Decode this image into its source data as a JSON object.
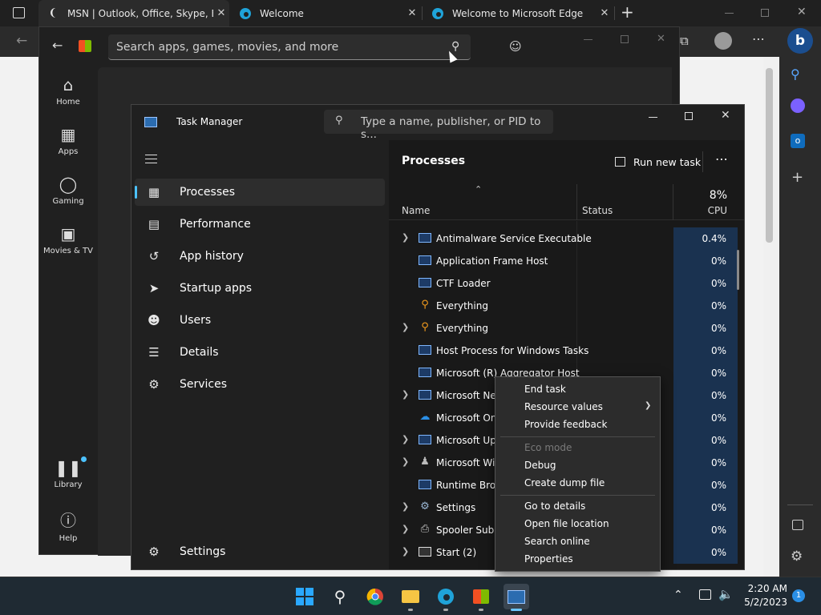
{
  "edge": {
    "tabs": [
      {
        "title": "MSN | Outlook, Office, Skype, Bi"
      },
      {
        "title": "Welcome"
      },
      {
        "title": "Welcome to Microsoft Edge"
      }
    ],
    "new_tab": "+"
  },
  "store": {
    "search_placeholder": "Search apps, games, movies, and more",
    "nav": [
      {
        "label": "Home",
        "icon": "home-icon"
      },
      {
        "label": "Apps",
        "icon": "apps-icon"
      },
      {
        "label": "Gaming",
        "icon": "gaming-icon"
      },
      {
        "label": "Movies & TV",
        "icon": "movies-icon"
      },
      {
        "label": "Library",
        "icon": "library-icon"
      },
      {
        "label": "Help",
        "icon": "help-icon"
      }
    ]
  },
  "task_manager": {
    "title": "Task Manager",
    "search_placeholder": "Type a name, publisher, or PID to s...",
    "nav": [
      {
        "label": "Processes"
      },
      {
        "label": "Performance"
      },
      {
        "label": "App history"
      },
      {
        "label": "Startup apps"
      },
      {
        "label": "Users"
      },
      {
        "label": "Details"
      },
      {
        "label": "Services"
      }
    ],
    "settings_label": "Settings",
    "page_title": "Processes",
    "run_new_task": "Run new task",
    "columns": {
      "name": "Name",
      "status": "Status",
      "cpu_pct": "8%",
      "cpu": "CPU"
    },
    "rows": [
      {
        "name": "Antimalware Service Executable",
        "cpu": "0.4%"
      },
      {
        "name": "Application Frame Host",
        "cpu": "0%"
      },
      {
        "name": "CTF Loader",
        "cpu": "0%"
      },
      {
        "name": "Everything",
        "cpu": "0%"
      },
      {
        "name": "Everything",
        "cpu": "0%"
      },
      {
        "name": "Host Process for Windows Tasks",
        "cpu": "0%"
      },
      {
        "name": "Microsoft (R) Aggregator Host",
        "cpu": "0%"
      },
      {
        "name": "Microsoft Net",
        "cpu": "0%"
      },
      {
        "name": "Microsoft One",
        "cpu": "0%"
      },
      {
        "name": "Microsoft Upd",
        "cpu": "0%"
      },
      {
        "name": "Microsoft Win",
        "cpu": "0%"
      },
      {
        "name": "Runtime Brok",
        "cpu": "0%"
      },
      {
        "name": "Settings",
        "cpu": "0%"
      },
      {
        "name": "Spooler SubSy",
        "cpu": "0%"
      },
      {
        "name": "Start (2)",
        "cpu": "0%"
      }
    ]
  },
  "context_menu": {
    "end_task": "End task",
    "resource_values": "Resource values",
    "provide_feedback": "Provide feedback",
    "eco_mode": "Eco mode",
    "debug": "Debug",
    "create_dump": "Create dump file",
    "go_to_details": "Go to details",
    "open_file_location": "Open file location",
    "search_online": "Search online",
    "properties": "Properties"
  },
  "taskbar": {
    "time": "2:20 AM",
    "date": "5/2/2023",
    "notification_count": "1"
  }
}
